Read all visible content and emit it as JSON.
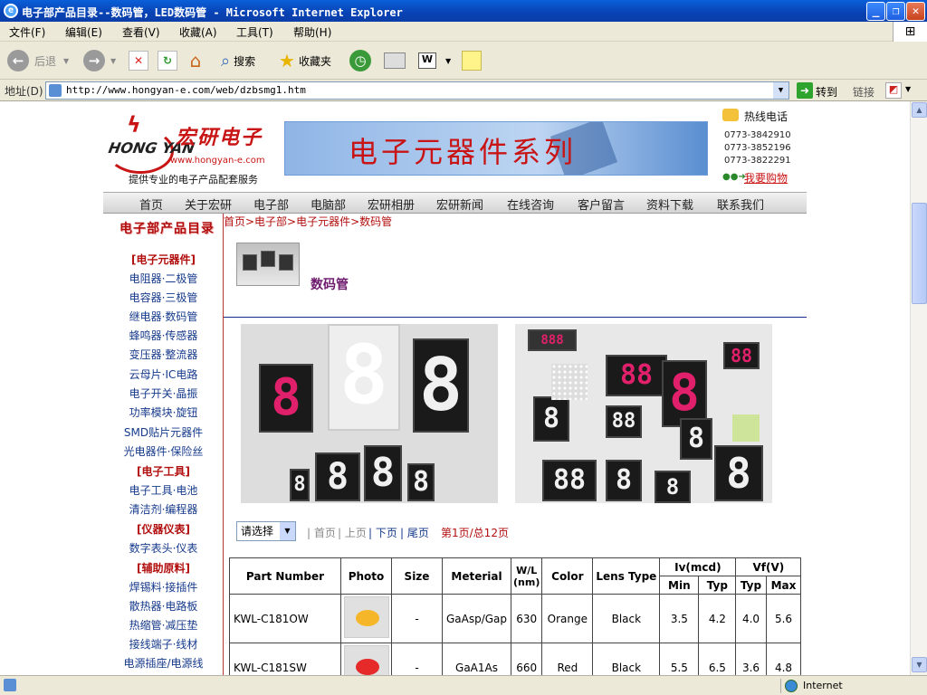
{
  "window": {
    "title": "电子部产品目录--数码管，LED数码管 - Microsoft Internet Explorer"
  },
  "menu": [
    "文件(F)",
    "编辑(E)",
    "查看(V)",
    "收藏(A)",
    "工具(T)",
    "帮助(H)"
  ],
  "toolbar": {
    "back": "后退",
    "search": "搜索",
    "favorites": "收藏夹"
  },
  "address": {
    "label": "地址(D)",
    "url": "http://www.hongyan-e.com/web/dzbsmg1.htm",
    "go": "转到",
    "links": "链接"
  },
  "status": {
    "zone": "Internet"
  },
  "header": {
    "logo_en": "HONG YAN",
    "logo_cn": "宏研电子",
    "logo_url": "www.hongyan-e.com",
    "slogan": "提供专业的电子产品配套服务",
    "banner": "电子元器件系列",
    "hotline_label": "热线电话",
    "phones": [
      "0773-3842910",
      "0773-3852196",
      "0773-3822291"
    ],
    "buy": "我要购物"
  },
  "nav": [
    "首页",
    "关于宏研",
    "电子部",
    "电脑部",
    "宏研相册",
    "宏研新闻",
    "在线咨询",
    "客户留言",
    "资料下载",
    "联系我们"
  ],
  "sidebar": {
    "title": "电子部产品目录",
    "sections": [
      {
        "cat": "[电子元器件]",
        "items": [
          "电阻器·二极管",
          "电容器·三极管",
          "继电器·数码管",
          "蜂鸣器·传感器",
          "变压器·整流器",
          "云母片·IC电路",
          "电子开关·晶振",
          "功率模块·旋钮",
          "SMD贴片元器件",
          "光电器件·保险丝"
        ]
      },
      {
        "cat": "[电子工具]",
        "items": [
          "电子工具·电池",
          "清洁剂·编程器"
        ]
      },
      {
        "cat": "[仪器仪表]",
        "items": [
          "数字表头·仪表"
        ]
      },
      {
        "cat": "[辅助原料]",
        "items": [
          "焊锡料·接插件",
          "散热器·电路板",
          "热缩管·减压垫",
          "接线端子·线材",
          "电源插座/电源线"
        ]
      }
    ]
  },
  "main": {
    "breadcrumb": "首页>电子部>电子元器件>数码管",
    "category_title": "数码管",
    "pager": {
      "select": "请选择",
      "first": "首页",
      "prev": "上页",
      "next": "下页",
      "last": "尾页",
      "info": "第1页/总12页"
    }
  },
  "table": {
    "headers": {
      "part": "Part Number",
      "photo": "Photo",
      "size": "Size",
      "material": "Meterial",
      "wl": "W/L (nm)",
      "color": "Color",
      "lens": "Lens Type",
      "iv": "Iv(mcd)",
      "vf": "Vf(V)",
      "min": "Min",
      "typ": "Typ",
      "typ2": "Typ",
      "max": "Max"
    },
    "rows": [
      {
        "part": "KWL-C181OW",
        "size": "-",
        "material": "GaAsp/Gap",
        "wl": "630",
        "color": "Orange",
        "lens": "Black",
        "iv_min": "3.5",
        "iv_typ": "4.2",
        "vf_typ": "4.0",
        "vf_max": "5.6",
        "dot": "#f5b62a"
      },
      {
        "part": "KWL-C181SW",
        "size": "-",
        "material": "GaA1As",
        "wl": "660",
        "color": "Red",
        "lens": "Black",
        "iv_min": "5.5",
        "iv_typ": "6.5",
        "vf_typ": "3.6",
        "vf_max": "4.8",
        "dot": "#e62a2a"
      }
    ]
  }
}
